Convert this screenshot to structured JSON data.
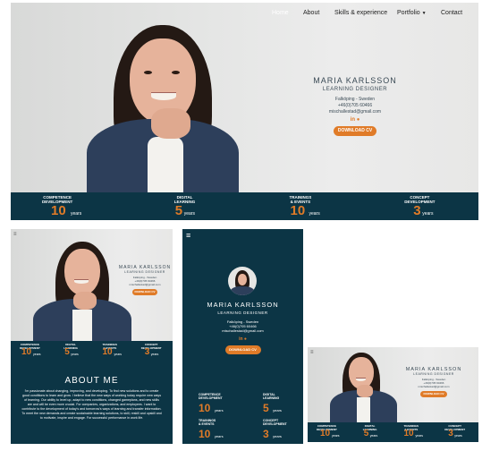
{
  "nav": {
    "home": "Home",
    "about": "About",
    "skills": "Skills & experience",
    "portfolio": "Portfolio",
    "contact": "Contact"
  },
  "profile": {
    "name": "MARIA KARLSSON",
    "role": "LEARNING DESIGNER",
    "location": "Falköping - Sweden",
    "phone": "+46(0)705 60466",
    "email": "mischallestad@gmail.com",
    "cv_button": "DOWNLOAD CV",
    "social": "in ⬤"
  },
  "stats": [
    {
      "label1": "COMPETENCE",
      "label2": "DEVELOPMENT",
      "number": "10",
      "unit": "years"
    },
    {
      "label1": "DIGITAL",
      "label2": "LEARNING",
      "number": "5",
      "unit": "years"
    },
    {
      "label1": "TRAININGS",
      "label2": "& EVENTS",
      "number": "10",
      "unit": "years"
    },
    {
      "label1": "CONCEPT",
      "label2": "DEVELOPMENT",
      "number": "3",
      "unit": "years"
    }
  ],
  "about": {
    "heading": "ABOUT ME",
    "text": "I'm passionate about changing, improving, and developing. To find new solutions and to create good conditions to learn and grow. I believe that the new ways of working today require new ways of learning. Our ability to level up, adapt to new conditions, changed gameplans, and new skills are and will be even more crucial. For companies, organizations, and employees. I want to contribute to the development of today's and tomorrow's ways of learning and transfer information. To meet the new demands and create sustainable learning solutions, to skill, reskill and upskill and to motivate, inspire and engage. For successful performance in work life."
  },
  "colors": {
    "accent": "#e07b28",
    "dark": "#0c3545"
  },
  "icons": {
    "menu": "hamburger-menu-icon",
    "linkedin": "linkedin-icon",
    "github": "github-icon"
  }
}
